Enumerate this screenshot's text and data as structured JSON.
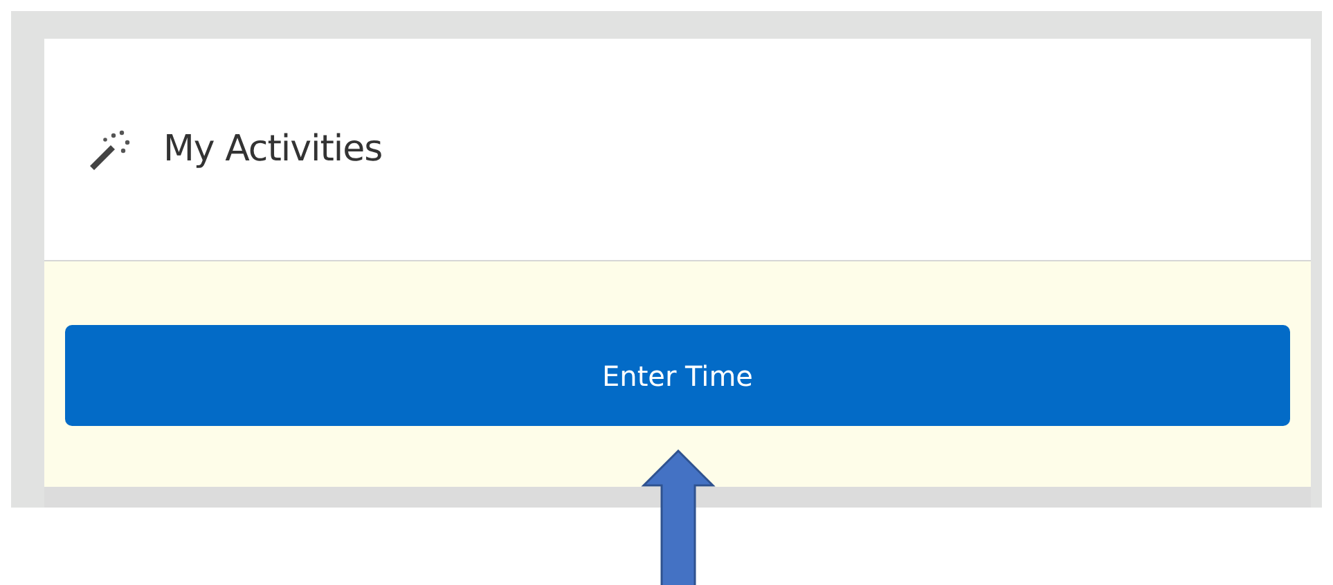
{
  "card": {
    "title": "My Activities"
  },
  "action_button": {
    "label": "Enter Time"
  }
}
